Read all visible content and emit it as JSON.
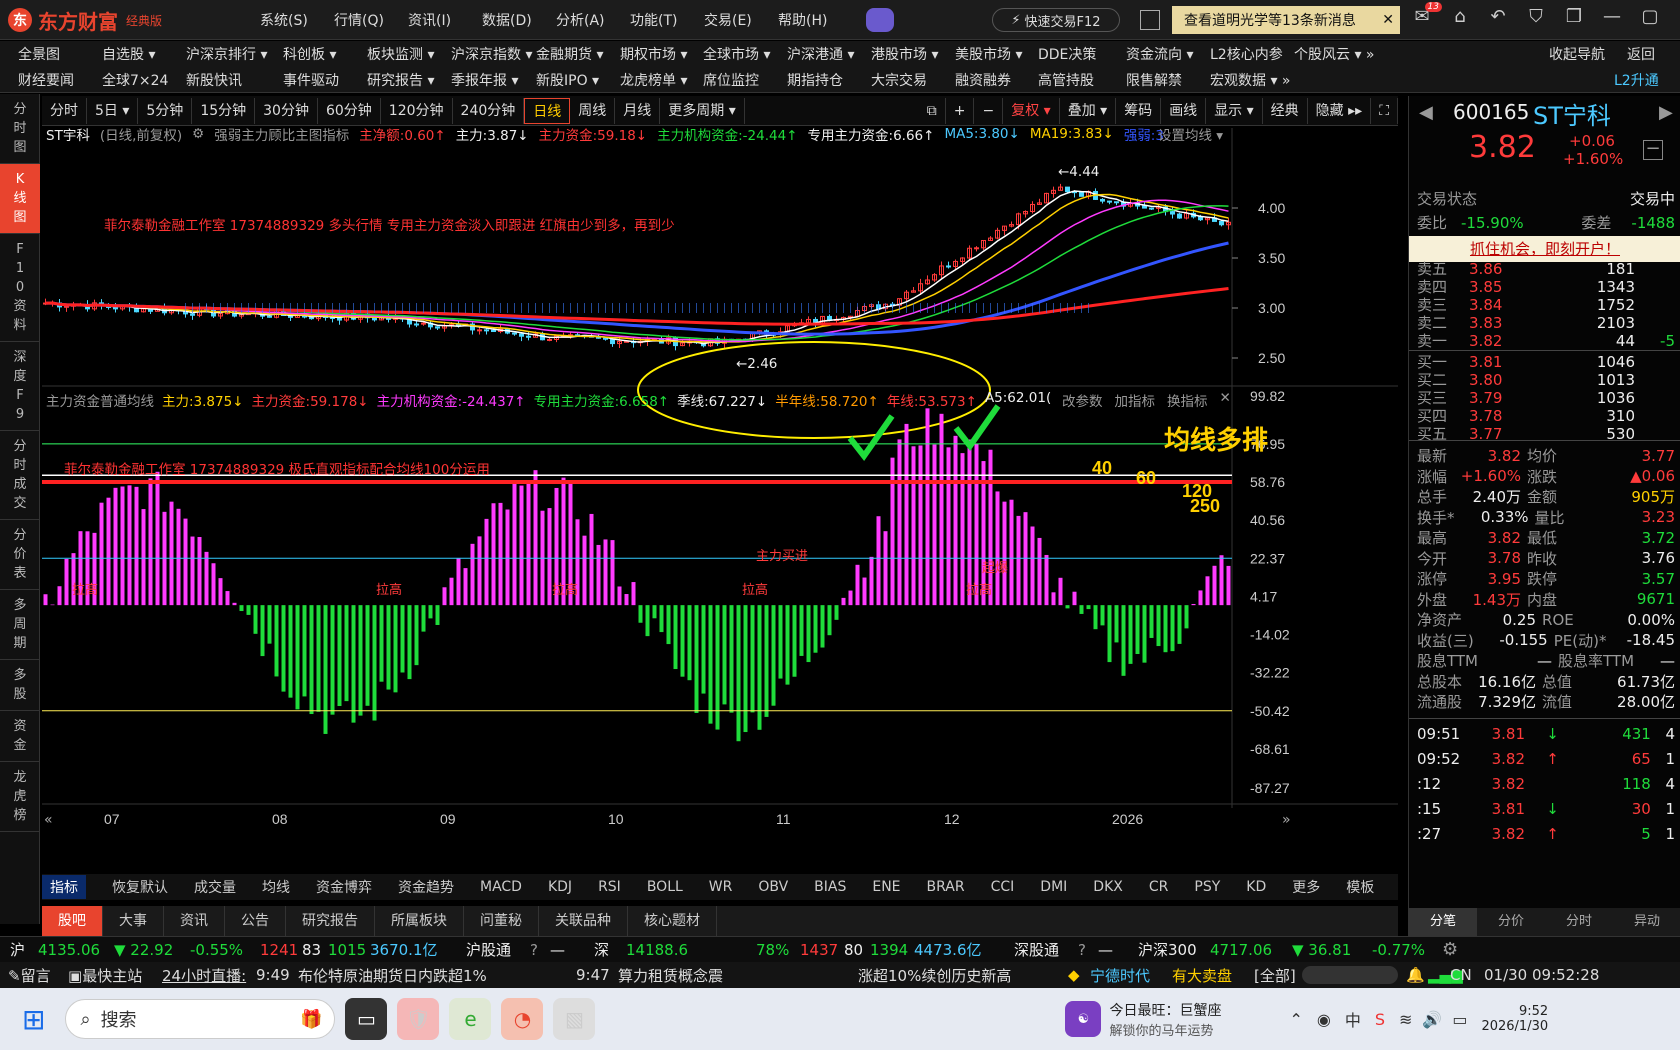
{
  "app": {
    "name": "东方财富",
    "edition": "经典版"
  },
  "menu": [
    "系统(S)",
    "行情(Q)",
    "资讯(I)",
    "数据(D)",
    "分析(A)",
    "功能(T)",
    "交易(E)",
    "帮助(H)"
  ],
  "quick_trade": "快速交易F12",
  "news_banner": "查看道明光学等13条新消息",
  "notification_count": "13",
  "nav_row1": [
    "全景图",
    "自选股 ▾",
    "沪深京排行 ▾",
    "科创板 ▾",
    "板块监测 ▾",
    "沪深京指数 ▾",
    "金融期货 ▾",
    "期权市场 ▾",
    "全球市场 ▾",
    "沪深港通 ▾",
    "港股市场 ▾",
    "美股市场 ▾",
    "DDE决策",
    "资金流向 ▾",
    "L2核心内参",
    "个股风云 ▾ »",
    "收起导航",
    "返回"
  ],
  "nav_row2": [
    "财经要闻",
    "全球7×24",
    "新股快讯",
    "事件驱动",
    "研究报告 ▾",
    "季报年报 ▾",
    "新股IPO ▾",
    "龙虎榜单 ▾",
    "席位监控",
    "期指持仓",
    "大宗交易",
    "融资融券",
    "高管持股",
    "限售解禁",
    "宏观数据 ▾ »",
    "L2升通"
  ],
  "sidebar": [
    "分时图",
    "K线图",
    "F10资料",
    "深度F9",
    "分时成交",
    "分价表",
    "多周期",
    "多股",
    "资金",
    "龙虎榜"
  ],
  "periods": [
    "分时",
    "5日 ▾",
    "5分钟",
    "15分钟",
    "30分钟",
    "60分钟",
    "120分钟",
    "240分钟",
    "日线",
    "周线",
    "月线",
    "更多周期 ▾"
  ],
  "chart_tools": [
    "⧉",
    "+",
    "−",
    "复权 ▾",
    "叠加 ▾",
    "筹码",
    "画线",
    "显示 ▾",
    "经典",
    "隐藏 ▸▸",
    "⛶"
  ],
  "main_chart": {
    "title": "ST宇科",
    "subtitle": "(日线,前复权)",
    "indicator_name": "强弱主力顾比主图指标",
    "legend": [
      {
        "text": "主净额:0.60↑",
        "color": "#ff3b3b"
      },
      {
        "text": "主力:3.87↓",
        "color": "#eeeeee"
      },
      {
        "text": "主力资金:59.18↓",
        "color": "#ff3b3b"
      },
      {
        "text": "主力机构资金:-24.44↑",
        "color": "#1fdc3b"
      },
      {
        "text": "专用主力资金:6.66↑",
        "color": "#eeeeee"
      },
      {
        "text": "MA5:3.80↓",
        "color": "#4cc9ff"
      },
      {
        "text": "MA19:3.83↓",
        "color": "#ffd000"
      },
      {
        "text": "强弱:3.",
        "color": "#3355ff"
      }
    ],
    "set_ma": "设置均线 ▾",
    "annotation": "菲尔泰勒金融工作室 17374889329 多头行情 专用主力资金淡入即跟进 红旗由少到多，再到少",
    "high_label": "←4.44",
    "low_label": "←2.46",
    "y_ticks": [
      "4.00",
      "3.50",
      "3.00",
      "2.50"
    ]
  },
  "sub_chart": {
    "title": "主力资金普通均线",
    "legend": [
      {
        "text": "主力:3.875↓",
        "color": "#ffd000"
      },
      {
        "text": "主力资金:59.178↓",
        "color": "#ff3b3b"
      },
      {
        "text": "主力机构资金:-24.437↑",
        "color": "#ff3bff"
      },
      {
        "text": "专用主力资金:6.658↑",
        "color": "#1fdc3b"
      },
      {
        "text": "季线:67.227↓",
        "color": "#eeeeee"
      },
      {
        "text": "半年线:58.720↑",
        "color": "#ff9900"
      },
      {
        "text": "年线:53.573↑",
        "color": "#ff3b3b"
      },
      {
        "text": "A5:62.01(",
        "color": "#eeeeee"
      }
    ],
    "links": [
      "改参数",
      "加指标",
      "换指标"
    ],
    "annotation": "菲尔泰勒金融工作室 17374889329 极氏直观指标配合均线100分运用",
    "big_label": "均线多排",
    "ma_labels": [
      "40",
      "60",
      "120",
      "250"
    ],
    "tags": [
      "拉高",
      "拉高",
      "拉高",
      "拉高",
      "拉高",
      "起爆",
      "主力买进"
    ],
    "y_ticks": [
      "99.82",
      "76.95",
      "58.76",
      "40.56",
      "22.37",
      "4.17",
      "-14.02",
      "-32.22",
      "-50.42",
      "-68.61",
      "-87.27"
    ]
  },
  "x_axis": [
    "07",
    "08",
    "09",
    "10",
    "11",
    "12",
    "2026"
  ],
  "bottom_tabs": [
    "指标",
    "恢复默认",
    "成交量",
    "均线",
    "资金博弈",
    "资金趋势",
    "MACD",
    "KDJ",
    "RSI",
    "BOLL",
    "WR",
    "OBV",
    "BIAS",
    "ENE",
    "BRAR",
    "CCI",
    "DMI",
    "DKX",
    "CR",
    "PSY",
    "KD",
    "更多",
    "模板"
  ],
  "info_tabs": [
    "股吧",
    "大事",
    "资讯",
    "公告",
    "研究报告",
    "所属板块",
    "问董秘",
    "关联品种",
    "核心题材"
  ],
  "stock": {
    "code": "600165",
    "name": "ST宁科",
    "price": "3.82",
    "change": "+0.06",
    "change_pct": "+1.60%",
    "status_label": "交易状态",
    "status": "交易中",
    "weibi_label": "委比",
    "weibi": "-15.90%",
    "weicha_label": "委差",
    "weicha": "-1488",
    "promo": "抓住机会，即刻开户！",
    "asks": [
      {
        "label": "卖五",
        "price": "3.86",
        "vol": "181",
        "delta": ""
      },
      {
        "label": "卖四",
        "price": "3.85",
        "vol": "1343",
        "delta": ""
      },
      {
        "label": "卖三",
        "price": "3.84",
        "vol": "1752",
        "delta": ""
      },
      {
        "label": "卖二",
        "price": "3.83",
        "vol": "2103",
        "delta": ""
      },
      {
        "label": "卖一",
        "price": "3.82",
        "vol": "44",
        "delta": "-5"
      }
    ],
    "bids": [
      {
        "label": "买一",
        "price": "3.81",
        "vol": "1046"
      },
      {
        "label": "买二",
        "price": "3.80",
        "vol": "1013"
      },
      {
        "label": "买三",
        "price": "3.79",
        "vol": "1036"
      },
      {
        "label": "买四",
        "price": "3.78",
        "vol": "310"
      },
      {
        "label": "买五",
        "price": "3.77",
        "vol": "530"
      }
    ],
    "stats": [
      {
        "l1": "最新",
        "v1": "3.82",
        "c1": "red",
        "l2": "均价",
        "v2": "3.77",
        "c2": "red"
      },
      {
        "l1": "涨幅",
        "v1": "+1.60%",
        "c1": "red",
        "l2": "涨跌",
        "v2": "▲0.06",
        "c2": "red"
      },
      {
        "l1": "总手",
        "v1": "2.40万",
        "c1": "white",
        "l2": "金额",
        "v2": "905万",
        "c2": "yellow"
      },
      {
        "l1": "换手*",
        "v1": "0.33%",
        "c1": "white",
        "l2": "量比",
        "v2": "3.23",
        "c2": "red"
      },
      {
        "l1": "最高",
        "v1": "3.82",
        "c1": "red",
        "l2": "最低",
        "v2": "3.72",
        "c2": "green"
      },
      {
        "l1": "今开",
        "v1": "3.78",
        "c1": "red",
        "l2": "昨收",
        "v2": "3.76",
        "c2": "white"
      },
      {
        "l1": "涨停",
        "v1": "3.95",
        "c1": "red",
        "l2": "跌停",
        "v2": "3.57",
        "c2": "green"
      },
      {
        "l1": "外盘",
        "v1": "1.43万",
        "c1": "red",
        "l2": "内盘",
        "v2": "9671",
        "c2": "green"
      },
      {
        "l1": "净资产",
        "v1": "0.25",
        "c1": "white",
        "l2": "ROE",
        "v2": "0.00%",
        "c2": "white"
      },
      {
        "l1": "收益(三)",
        "v1": "-0.155",
        "c1": "white",
        "l2": "PE(动)*",
        "v2": "-18.45",
        "c2": "white"
      },
      {
        "l1": "股息TTM",
        "v1": "—",
        "c1": "white",
        "l2": "股息率TTM",
        "v2": "—",
        "c2": "white"
      },
      {
        "l1": "总股本",
        "v1": "16.16亿",
        "c1": "white",
        "l2": "总值",
        "v2": "61.73亿",
        "c2": "white"
      },
      {
        "l1": "流通股",
        "v1": "7.329亿",
        "c1": "white",
        "l2": "流值",
        "v2": "28.00亿",
        "c2": "white"
      }
    ],
    "trades": [
      {
        "time": "09:51",
        "price": "3.81",
        "dir": "↓",
        "vol": "431",
        "n": "4"
      },
      {
        "time": "09:52",
        "price": "3.82",
        "dir": "↑",
        "vol": "65",
        "n": "1"
      },
      {
        "time": ":12",
        "price": "3.82",
        "dir": "",
        "vol": "118",
        "n": "4"
      },
      {
        "time": ":15",
        "price": "3.81",
        "dir": "↓",
        "vol": "30",
        "n": "1"
      },
      {
        "time": ":27",
        "price": "3.82",
        "dir": "↑",
        "vol": "5",
        "n": "1"
      }
    ],
    "right_tabs": [
      "分笔",
      "分价",
      "分时",
      "异动"
    ]
  },
  "index_bar": {
    "sh_label": "沪",
    "sh_value": "4135.06",
    "sh_change": "▼ 22.92",
    "sh_pct": "-0.55%",
    "sh_up": "1241",
    "sh_flat": "83",
    "sh_down": "1015",
    "sh_amount": "3670.1亿",
    "hgt": "沪股通",
    "hgt_v": "—",
    "sz_label": "深",
    "sz_value": "14188.6",
    "sz_pct": "78%",
    "sz_up": "1437",
    "sz_flat": "80",
    "sz_down": "1394",
    "sz_amount": "4473.6亿",
    "sgt": "深股通",
    "sgt_v": "—",
    "hs300_label": "沪深300",
    "hs300_value": "4717.06",
    "hs300_change": "▼ 36.81",
    "hs300_pct": "-0.77%"
  },
  "ticker": {
    "msg": "留言",
    "fav": "最快主站",
    "live": "24小时直播:",
    "t1": "9:49",
    "n1": "布伦特原油期货日内跌超1%",
    "t2": "9:47",
    "n2": "算力租赁概念震",
    "n3": "涨超10%续创历史新高",
    "stock": "宁德时代",
    "deal": "有大卖盘",
    "all": "[全部]",
    "cn": "CN",
    "date": "01/30",
    "time": "09:52:28"
  },
  "taskbar": {
    "search": "搜索",
    "news_title": "今日最旺：巨蟹座",
    "news_sub": "解锁你的马年运势",
    "time": "9:52",
    "date": "2026/1/30",
    "lang": "中"
  },
  "chart_data": {
    "type": "candlestick",
    "title": "ST宇科 (日线,前复权)",
    "x_labels": [
      "07",
      "08",
      "09",
      "10",
      "11",
      "12",
      "2026"
    ],
    "price_range": [
      2.3,
      4.6
    ],
    "high": 4.44,
    "low": 2.46,
    "close": 3.82,
    "monthly_closes": [
      3.05,
      2.95,
      2.9,
      2.7,
      2.65,
      3.05,
      4.2,
      3.82
    ],
    "sub_range": [
      -87.27,
      99.82
    ]
  }
}
